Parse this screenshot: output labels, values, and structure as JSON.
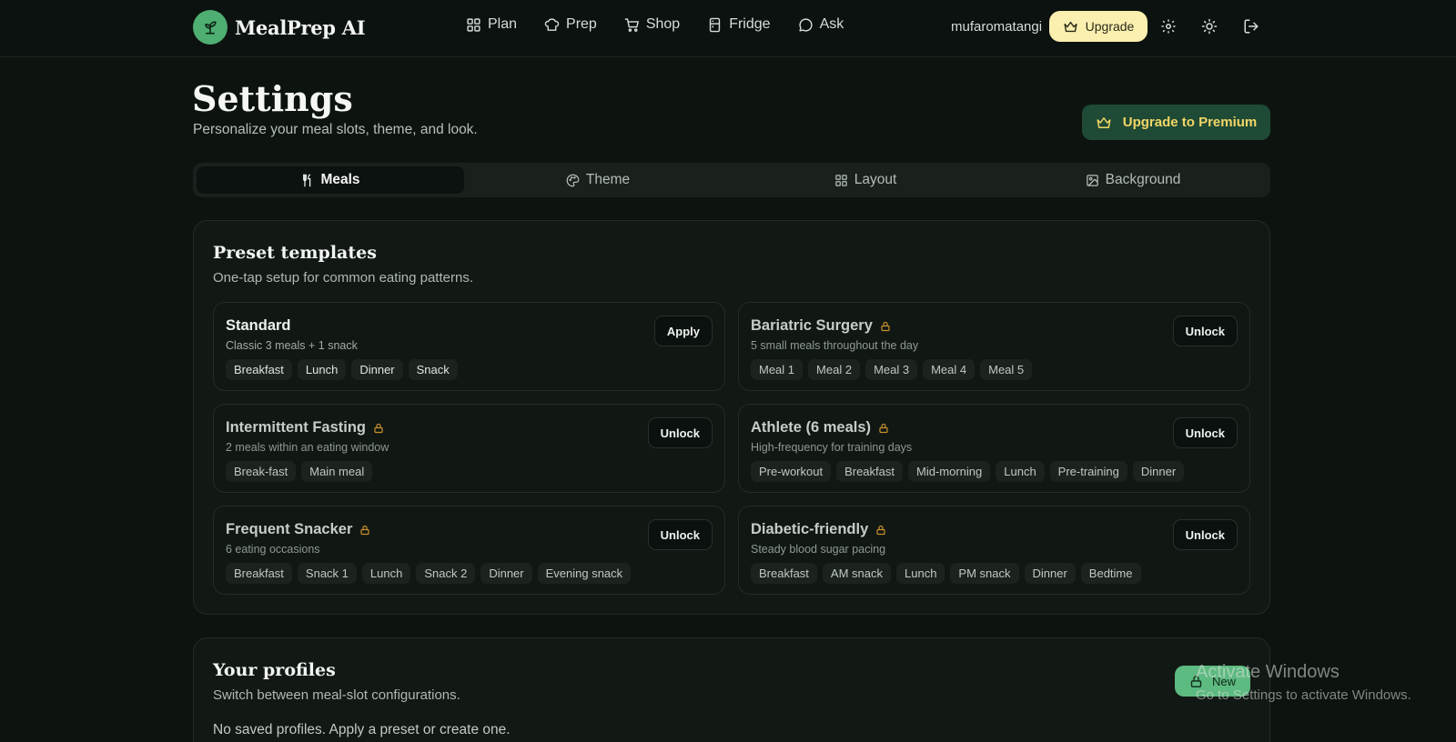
{
  "header": {
    "brand": "MealPrep AI",
    "nav": [
      {
        "label": "Plan",
        "icon": "grid-icon"
      },
      {
        "label": "Prep",
        "icon": "chef-hat-icon"
      },
      {
        "label": "Shop",
        "icon": "cart-icon"
      },
      {
        "label": "Fridge",
        "icon": "fridge-icon"
      },
      {
        "label": "Ask",
        "icon": "chat-icon"
      }
    ],
    "username": "mufaromatangi",
    "upgrade_label": "Upgrade"
  },
  "page": {
    "title": "Settings",
    "subtitle": "Personalize your meal slots, theme, and look.",
    "premium_label": "Upgrade to Premium"
  },
  "tabs": [
    {
      "label": "Meals",
      "icon": "utensils-icon",
      "active": true
    },
    {
      "label": "Theme",
      "icon": "palette-icon",
      "active": false
    },
    {
      "label": "Layout",
      "icon": "layout-icon",
      "active": false
    },
    {
      "label": "Background",
      "icon": "image-icon",
      "active": false
    }
  ],
  "presets": {
    "title": "Preset templates",
    "subtitle": "One-tap setup for common eating patterns.",
    "items": [
      {
        "name": "Standard",
        "desc": "Classic 3 meals + 1 snack",
        "chips": [
          "Breakfast",
          "Lunch",
          "Dinner",
          "Snack"
        ],
        "action": "Apply",
        "locked": false
      },
      {
        "name": "Bariatric Surgery",
        "desc": "5 small meals throughout the day",
        "chips": [
          "Meal 1",
          "Meal 2",
          "Meal 3",
          "Meal 4",
          "Meal 5"
        ],
        "action": "Unlock",
        "locked": true
      },
      {
        "name": "Intermittent Fasting",
        "desc": "2 meals within an eating window",
        "chips": [
          "Break-fast",
          "Main meal"
        ],
        "action": "Unlock",
        "locked": true
      },
      {
        "name": "Athlete (6 meals)",
        "desc": "High-frequency for training days",
        "chips": [
          "Pre-workout",
          "Breakfast",
          "Mid-morning",
          "Lunch",
          "Pre-training",
          "Dinner"
        ],
        "action": "Unlock",
        "locked": true
      },
      {
        "name": "Frequent Snacker",
        "desc": "6 eating occasions",
        "chips": [
          "Breakfast",
          "Snack 1",
          "Lunch",
          "Snack 2",
          "Dinner",
          "Evening snack"
        ],
        "action": "Unlock",
        "locked": true
      },
      {
        "name": "Diabetic-friendly",
        "desc": "Steady blood sugar pacing",
        "chips": [
          "Breakfast",
          "AM snack",
          "Lunch",
          "PM snack",
          "Dinner",
          "Bedtime"
        ],
        "action": "Unlock",
        "locked": true
      }
    ]
  },
  "profiles": {
    "title": "Your profiles",
    "subtitle": "Switch between meal-slot configurations.",
    "empty": "No saved profiles. Apply a preset or create one.",
    "new_label": "New"
  },
  "watermark": {
    "line1": "Activate Windows",
    "line2": "Go to Settings to activate Windows."
  },
  "colors": {
    "accent": "#4fae72",
    "premium_bg": "#1f4a35",
    "premium_text": "#f1d667",
    "lock": "#c9902f"
  }
}
